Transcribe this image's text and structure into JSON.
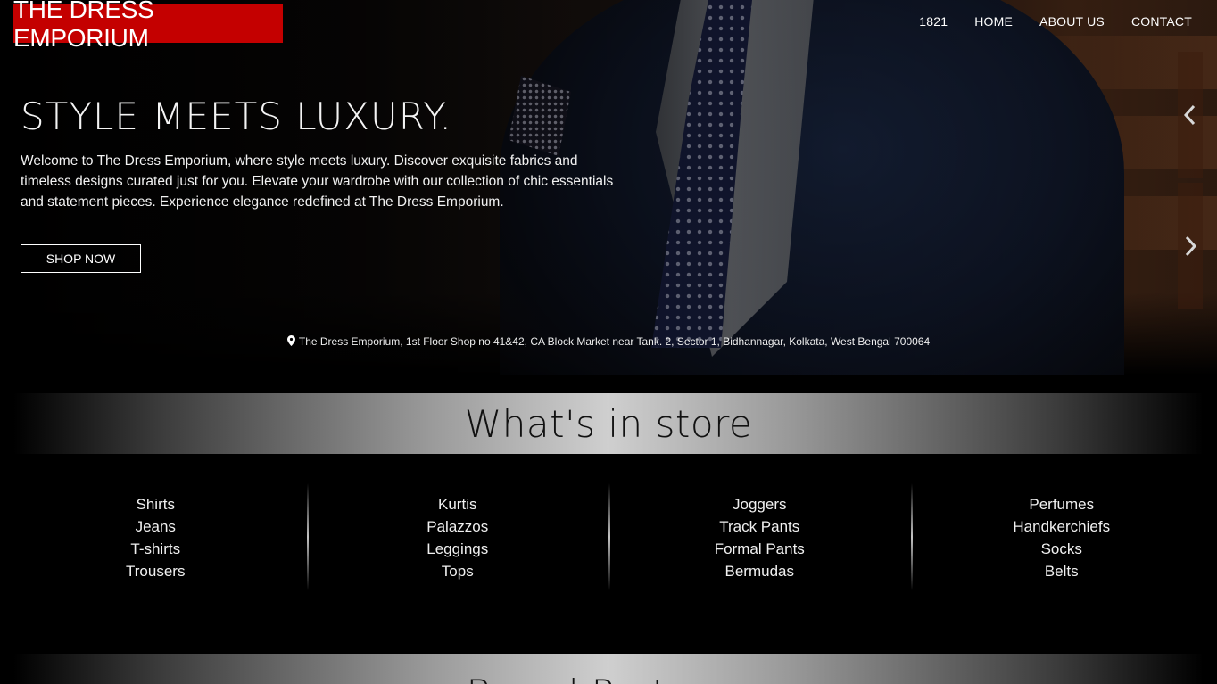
{
  "brand": {
    "name": "THE DRESS EMPORIUM",
    "color": "#c40000"
  },
  "nav": {
    "items": [
      {
        "label": "1821"
      },
      {
        "label": "HOME"
      },
      {
        "label": "ABOUT US"
      },
      {
        "label": "CONTACT"
      }
    ]
  },
  "hero": {
    "title": "STYLE MEETS LUXURY.",
    "text": "Welcome to The Dress Emporium, where style meets luxury. Discover exquisite fabrics and timeless designs curated just for you. Elevate your wardrobe with our collection of chic essentials and statement pieces. Experience elegance redefined at The Dress Emporium.",
    "button": "SHOP NOW",
    "prev_icon": "chevron-left-icon",
    "next_icon": "chevron-right-icon",
    "address_icon": "map-pin-icon",
    "address": "The Dress Emporium, 1st Floor Shop no 41&42, CA Block Market near Tank. 2, Sector 1, Bidhannagar, Kolkata, West Bengal 700064"
  },
  "store": {
    "title": "What's in store",
    "columns": [
      {
        "items": [
          "Shirts",
          "Jeans",
          "T-shirts",
          "Trousers"
        ]
      },
      {
        "items": [
          "Kurtis",
          "Palazzos",
          "Leggings",
          "Tops"
        ]
      },
      {
        "items": [
          "Joggers",
          "Track Pants",
          "Formal Pants",
          "Bermudas"
        ]
      },
      {
        "items": [
          "Perfumes",
          "Handkerchiefs",
          "Socks",
          "Belts"
        ]
      }
    ]
  },
  "partners": {
    "title": "Brand Partners"
  }
}
